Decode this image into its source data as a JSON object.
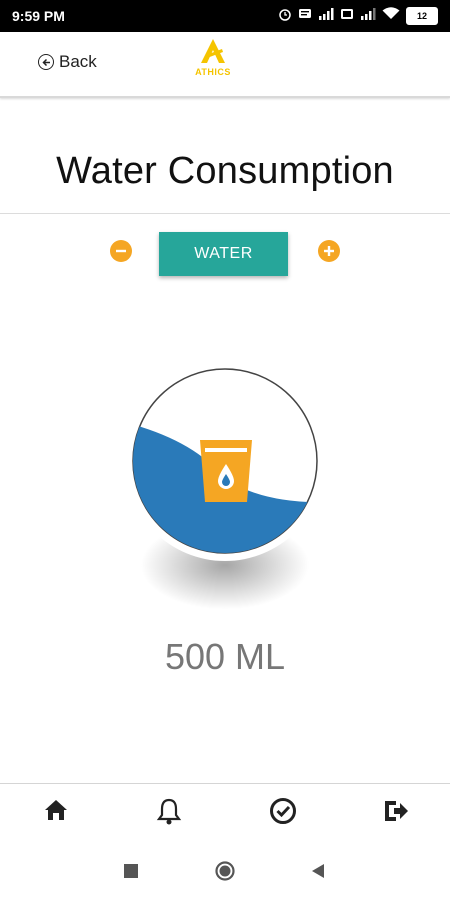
{
  "status_bar": {
    "time": "9:59 PM",
    "battery": "12",
    "icons": [
      "alarm-icon",
      "message-icon",
      "signal-icon",
      "sim-icon",
      "signal-icon",
      "wifi-icon",
      "battery-icon"
    ]
  },
  "app_bar": {
    "back_label": "Back",
    "logo_text": "ATHICS",
    "logo_color": "#f5c400"
  },
  "page": {
    "title": "Water Consumption",
    "water_button_label": "WATER",
    "amount": "500 ML"
  },
  "glass": {
    "fill_color": "#2a7ab9",
    "cup_color": "#f5a623"
  },
  "colors": {
    "accent_orange": "#f5a623",
    "button_teal": "#26a69a"
  },
  "bottom_nav": {
    "items": [
      "home-icon",
      "bell-icon",
      "check-circle-icon",
      "logout-icon"
    ]
  },
  "system_nav": {
    "items": [
      "recent-apps-icon",
      "home-circle-icon",
      "back-triangle-icon"
    ]
  }
}
